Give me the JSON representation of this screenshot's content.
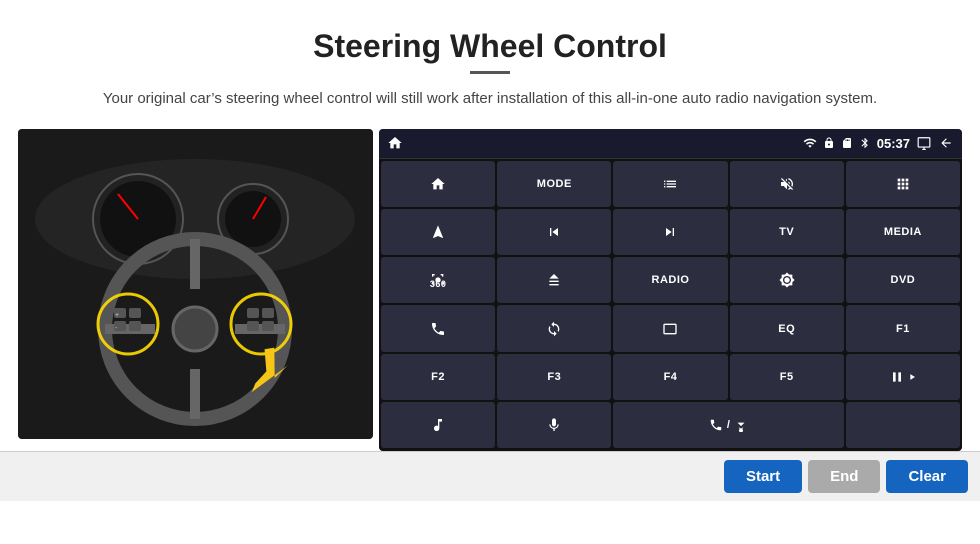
{
  "title": "Steering Wheel Control",
  "divider": true,
  "subtitle": "Your original car’s steering wheel control will still work after installation of this all-in-one auto radio navigation system.",
  "statusBar": {
    "wifi": "wifi-icon",
    "lock": "lock-icon",
    "sd": "sd-icon",
    "bluetooth": "bluetooth-icon",
    "time": "05:37",
    "screen": "screen-icon",
    "back": "back-icon"
  },
  "buttons": [
    {
      "label": "",
      "icon": "home"
    },
    {
      "label": "MODE",
      "icon": ""
    },
    {
      "label": "",
      "icon": "list"
    },
    {
      "label": "",
      "icon": "mute"
    },
    {
      "label": "",
      "icon": "apps"
    },
    {
      "label": "",
      "icon": "navigate"
    },
    {
      "label": "",
      "icon": "prev"
    },
    {
      "label": "",
      "icon": "next"
    },
    {
      "label": "TV",
      "icon": ""
    },
    {
      "label": "MEDIA",
      "icon": ""
    },
    {
      "label": "",
      "icon": "360cam"
    },
    {
      "label": "",
      "icon": "eject"
    },
    {
      "label": "RADIO",
      "icon": ""
    },
    {
      "label": "",
      "icon": "brightness"
    },
    {
      "label": "DVD",
      "icon": ""
    },
    {
      "label": "",
      "icon": "phone"
    },
    {
      "label": "",
      "icon": "swirl"
    },
    {
      "label": "",
      "icon": "window"
    },
    {
      "label": "EQ",
      "icon": ""
    },
    {
      "label": "F1",
      "icon": ""
    },
    {
      "label": "F2",
      "icon": ""
    },
    {
      "label": "F3",
      "icon": ""
    },
    {
      "label": "F4",
      "icon": ""
    },
    {
      "label": "F5",
      "icon": ""
    },
    {
      "label": "",
      "icon": "playpause"
    },
    {
      "label": "",
      "icon": "music"
    },
    {
      "label": "",
      "icon": "mic"
    },
    {
      "label": "",
      "icon": "phonecall"
    },
    {
      "label": "",
      "icon": ""
    },
    {
      "label": "",
      "icon": ""
    }
  ],
  "bottomBar": {
    "start": "Start",
    "end": "End",
    "clear": "Clear"
  }
}
